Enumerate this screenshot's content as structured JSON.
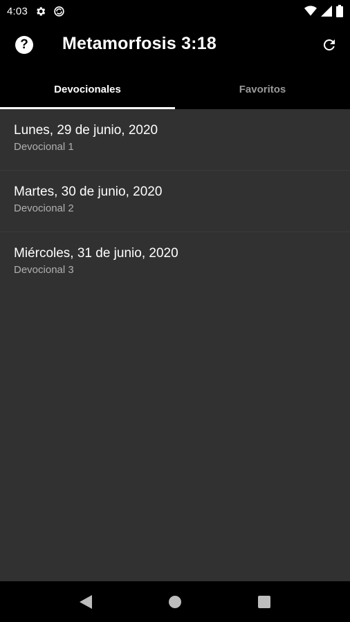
{
  "status_bar": {
    "time": "4:03",
    "icons": [
      "settings-icon",
      "sync-icon",
      "wifi-icon",
      "signal-icon",
      "battery-icon"
    ]
  },
  "app_bar": {
    "help_icon": "help-icon",
    "help_glyph": "?",
    "title": "Metamorfosis 3:18",
    "refresh_icon": "refresh-icon"
  },
  "tabs": [
    {
      "label": "Devocionales",
      "active": true
    },
    {
      "label": "Favoritos",
      "active": false
    }
  ],
  "devotionals": [
    {
      "title": "Lunes, 29 de junio, 2020",
      "subtitle": "Devocional 1"
    },
    {
      "title": "Martes, 30 de junio, 2020",
      "subtitle": "Devocional 2"
    },
    {
      "title": "Miércoles, 31 de junio, 2020",
      "subtitle": "Devocional 3"
    }
  ],
  "nav_bar": {
    "icons": [
      "back-icon",
      "home-icon",
      "recents-icon"
    ]
  },
  "colors": {
    "background": "#313131",
    "bar": "#000000",
    "text_primary": "#ffffff",
    "text_secondary": "#b0b0b0",
    "tab_inactive": "#9a9a9a"
  }
}
